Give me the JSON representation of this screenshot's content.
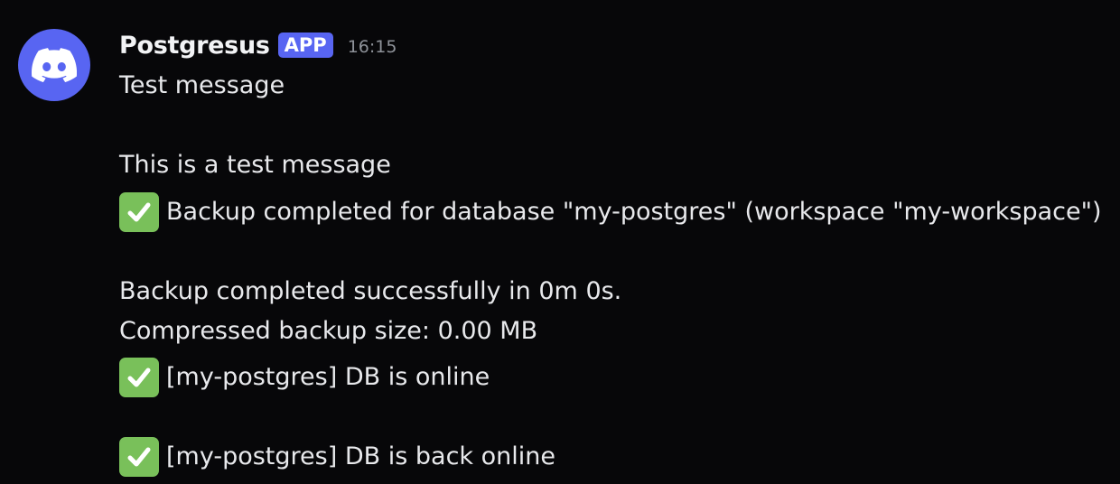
{
  "author": {
    "name": "Postgresus",
    "badge": "APP",
    "timestamp": "16:15",
    "avatar_icon": "discord-logo-icon",
    "avatar_color": "#5865f2"
  },
  "lines": {
    "l1": "Test message",
    "l2": "This is a test message",
    "l3": "Backup completed for database \"my-postgres\" (workspace \"my-workspace\")",
    "l4": "Backup completed successfully in 0m 0s.",
    "l5": "Compressed backup size: 0.00 MB",
    "l6": "[my-postgres] DB is online",
    "l7": "[my-postgres] DB is back online"
  },
  "icons": {
    "check": "check-mark-emoji-icon",
    "check_color": "#79c05a"
  }
}
